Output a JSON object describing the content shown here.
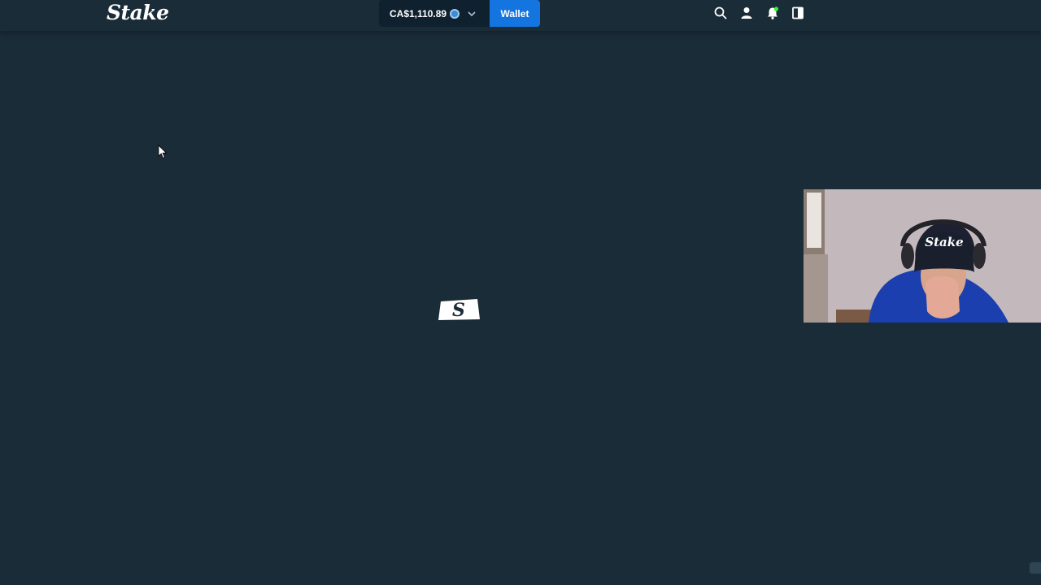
{
  "header": {
    "logo_text": "Stake",
    "balance": "CA$1,110.89",
    "wallet_label": "Wallet"
  },
  "icons": {
    "balance_currency": "coin-icon",
    "balance_dropdown": "chevron-down-icon",
    "search": "search-icon",
    "user": "user-icon",
    "notifications": "bell-icon",
    "sidebar_toggle": "panel-toggle-icon",
    "loader": "stake-logo-icon",
    "cursor": "mouse-pointer-icon"
  },
  "webcam": {
    "cap_text": "Stake"
  },
  "colors": {
    "background": "#1a2c38",
    "balance_bg": "#0f212e",
    "wallet_button": "#1475e1",
    "coin": "#3e8bd6",
    "notification_dot": "#1fff20"
  }
}
